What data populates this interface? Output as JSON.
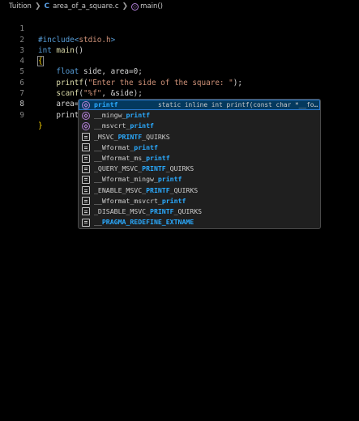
{
  "breadcrumb": {
    "folder": "Tuition",
    "file": "area_of_a_square.c",
    "symbol": "main()"
  },
  "editor": {
    "active_line": "8",
    "lines": [
      {
        "num": "1",
        "text": "#include<stdio.h>"
      },
      {
        "num": "2",
        "text": "int main()"
      },
      {
        "num": "3",
        "text": "{"
      },
      {
        "num": "4",
        "text": "    float side, area=0;"
      },
      {
        "num": "5",
        "text": "    printf(\"Enter the side of the square: \");"
      },
      {
        "num": "6",
        "text": "    scanf(\"%f\", &side);"
      },
      {
        "num": "7",
        "text": "    area= side*side;"
      },
      {
        "num": "8",
        "text": "    print"
      },
      {
        "num": "9",
        "text": "}"
      }
    ]
  },
  "suggestions": {
    "selected_detail": "static inline int printf(const char *__fo…",
    "items": [
      {
        "kind": "function",
        "label": "printf",
        "pre": "",
        "match": "printf",
        "post": ""
      },
      {
        "kind": "function",
        "label": "__mingw_printf",
        "pre": "__mingw_",
        "match": "printf",
        "post": ""
      },
      {
        "kind": "function",
        "label": "__msvcrt_printf",
        "pre": "__msvcrt_",
        "match": "printf",
        "post": ""
      },
      {
        "kind": "macro",
        "label": "_MSVC_PRINTF_QUIRKS",
        "pre": "_MSVC_",
        "match": "PRINTF",
        "post": "_QUIRKS"
      },
      {
        "kind": "macro",
        "label": "__Wformat_printf",
        "pre": "__Wformat_",
        "match": "printf",
        "post": ""
      },
      {
        "kind": "macro",
        "label": "__Wformat_ms_printf",
        "pre": "__Wformat_ms_",
        "match": "printf",
        "post": ""
      },
      {
        "kind": "macro",
        "label": "_QUERY_MSVC_PRINTF_QUIRKS",
        "pre": "_QUERY_MSVC_",
        "match": "PRINTF",
        "post": "_QUIRKS"
      },
      {
        "kind": "macro",
        "label": "__Wformat_mingw_printf",
        "pre": "__Wformat_mingw_",
        "match": "printf",
        "post": ""
      },
      {
        "kind": "macro",
        "label": "_ENABLE_MSVC_PRINTF_QUIRKS",
        "pre": "_ENABLE_MSVC_",
        "match": "PRINTF",
        "post": "_QUIRKS"
      },
      {
        "kind": "macro",
        "label": "__Wformat_msvcrt_printf",
        "pre": "__Wformat_msvcrt_",
        "match": "printf",
        "post": ""
      },
      {
        "kind": "macro",
        "label": "_DISABLE_MSVC_PRINTF_QUIRKS",
        "pre": "_DISABLE_MSVC_",
        "match": "PRINTF",
        "post": "_QUIRKS"
      },
      {
        "kind": "macro",
        "label": "__PRAGMA_REDEFINE_EXTNAME",
        "pre": "__",
        "match": "PRAGMA_REDEFINE_EXTNAME",
        "post": ""
      }
    ]
  },
  "colors": {
    "background": "#000000",
    "keyword": "#569cd6",
    "function": "#dcdcaa",
    "string": "#ce9178",
    "match_highlight": "#2aaaff",
    "selection": "#04395e"
  },
  "icons": {
    "breadcrumb_separator": "chevron-right-icon",
    "file": "c-file-icon",
    "symbol": "method-cube-icon",
    "function_kind": "function-cube-icon",
    "macro_kind": "macro-symbol-icon"
  }
}
